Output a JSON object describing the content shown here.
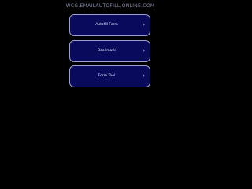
{
  "header": {
    "domain": "WCG.EMAILAUTOFILL.ONLINE.COM"
  },
  "links": [
    {
      "label": "Autofill Form"
    },
    {
      "label": "Bookmark"
    },
    {
      "label": "Form Tool"
    }
  ],
  "icons": {
    "chevron": "›"
  },
  "colors": {
    "background": "#000000",
    "button_fill": "#0a0a5c",
    "button_border": "#9aa0d0"
  }
}
